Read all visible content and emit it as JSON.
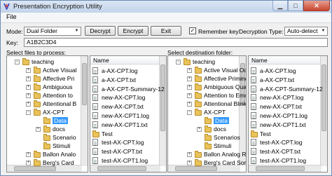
{
  "window": {
    "title": "Presentation Encryption Utility"
  },
  "menu": {
    "file": "File"
  },
  "controls": {
    "mode_label": "Mode:",
    "mode_value": "Dual Folder",
    "decrypt": "Decrypt",
    "encrypt": "Encrypt",
    "exit": "Exit",
    "remember_label": "Remember key",
    "remember_checked": "✓",
    "decryption_type_label": "Decryption Type:",
    "decryption_type_value": "Auto-detect",
    "key_label": "Key:",
    "key_value": "A1B2C3D4"
  },
  "source": {
    "label": "Select files to process:",
    "tree": [
      "teaching",
      "Active Visual",
      "Affective Pri",
      "Ambiguous",
      "Attention to",
      "Attentional B",
      "AX-CPT",
      "Data",
      "docs",
      "Scenario",
      "Stimuli",
      "Ballon Analo",
      "Berg's Card"
    ],
    "files_header": "Name",
    "files": [
      "a-AX-CPT.log",
      "a-AX-CPT.txt",
      "a-AX-CPT-Summary-12",
      "new-AX-CPT.log",
      "new-AX-CPT.txt",
      "new-AX-CPT1.log",
      "new-AX-CPT1.txt",
      "Test",
      "test-AX-CPT.log",
      "test-AX-CPT.txt",
      "test-AX-CPT1.log"
    ]
  },
  "destination": {
    "label": "Select destination folder:",
    "tree": [
      "teaching",
      "Active Visual Odd",
      "Affective Priming",
      "Ambiguous Quar",
      "Attention to Emo",
      "Attentional Blink",
      "AX-CPT",
      "Data",
      "docs",
      "Scenarios",
      "Stimuli",
      "Ballon Analog Ris",
      "Berg's Card Sorting"
    ],
    "files_header": "Name",
    "files": [
      "a-AX-CPT.log",
      "a-AX-CPT.txt",
      "a-AX-CPT-Summary-12",
      "new-AX-CPT.log",
      "new-AX-CPT.txt",
      "new-AX-CPT1.log",
      "new-AX-CPT1.txt",
      "Test",
      "test-AX-CPT.log",
      "test-AX-CPT.txt",
      "test-AX-CPT1.log"
    ]
  }
}
